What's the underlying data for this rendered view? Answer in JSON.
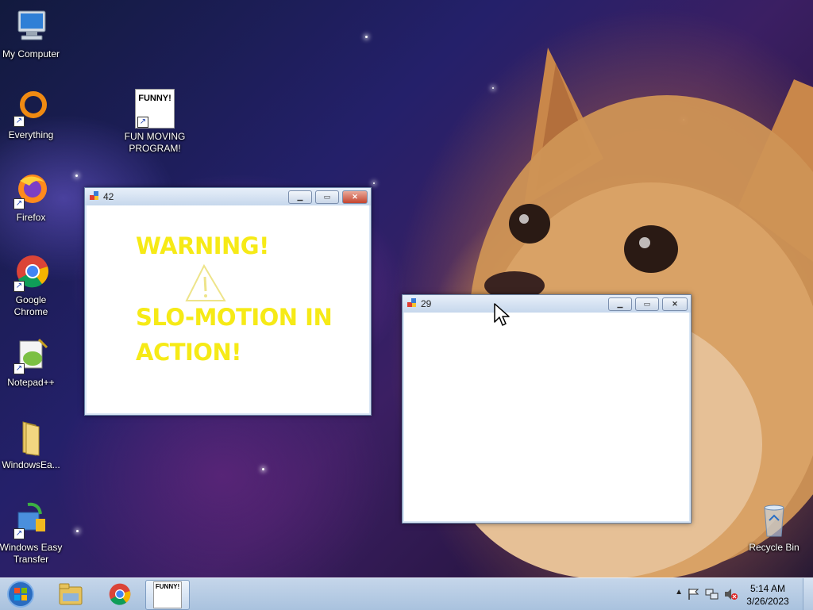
{
  "desktop": {
    "icons": [
      {
        "label": "My Computer",
        "icon": "computer-icon"
      },
      {
        "label": "Everything",
        "icon": "everything-icon"
      },
      {
        "label": "Firefox",
        "icon": "firefox-icon"
      },
      {
        "label": "Google Chrome",
        "icon": "chrome-icon"
      },
      {
        "label": "Notepad++",
        "icon": "notepadpp-icon"
      },
      {
        "label": "WindowsEa...",
        "icon": "folder-icon"
      },
      {
        "label": "Windows Easy Transfer",
        "icon": "easy-transfer-icon"
      },
      {
        "label": "FUN MOVING PROGRAM!",
        "icon": "funny-program-icon",
        "thumb_text": "FUNNY!"
      },
      {
        "label": "Recycle Bin",
        "icon": "recycle-bin-icon"
      }
    ]
  },
  "window_42": {
    "title": "42",
    "warning_line1": "WARNING!",
    "warning_line2": "SLO-MOTION IN",
    "warning_line3": "ACTION!",
    "text_color": "#f6ea16"
  },
  "window_29": {
    "title": "29"
  },
  "taskbar": {
    "start": "start-orb-icon",
    "pinned": [
      "explorer-icon",
      "chrome-icon",
      "funny-program-icon"
    ],
    "active_thumb_text": "FUNNY!",
    "clock_time": "5:14 AM",
    "clock_date": "3/26/2023"
  },
  "colors": {
    "taskbar": "#b6cbe3",
    "titlebar": "#d3e1f2",
    "close_button": "#c4442f"
  }
}
